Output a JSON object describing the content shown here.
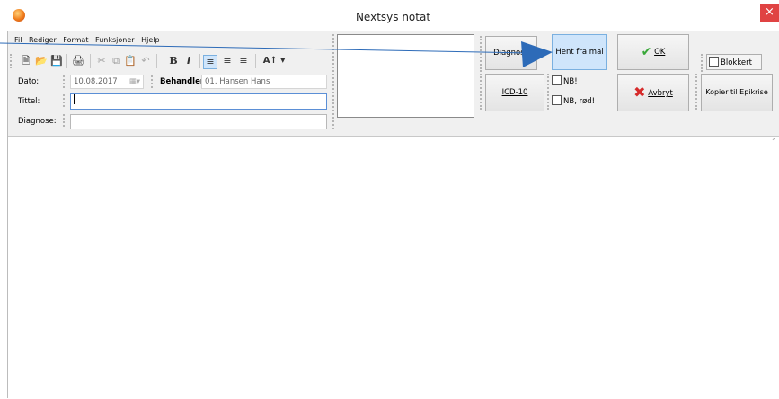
{
  "window": {
    "title": "Nextsys notat",
    "close_glyph": "×"
  },
  "menu": {
    "items": [
      "Fil",
      "Rediger",
      "Format",
      "Funksjoner",
      "Hjelp"
    ]
  },
  "toolbar": {
    "icons": [
      "new-document-icon",
      "open-folder-icon",
      "save-icon",
      "print-icon",
      "cut-icon",
      "copy-icon",
      "paste-icon",
      "undo-icon",
      "bold-icon",
      "italic-icon",
      "align-left-icon",
      "align-center-icon",
      "align-right-icon",
      "font-size-icon"
    ],
    "bold_glyph": "B",
    "italic_glyph": "I",
    "font_glyph": "A↑ ▾"
  },
  "form": {
    "dato_label": "Dato:",
    "dato_value": "10.08.2017",
    "behandler_label": "Behandler:",
    "behandler_value": "01. Hansen Hans",
    "tittel_label": "Tittel:",
    "tittel_value": "",
    "diagnose_label": "Diagnose:",
    "diagnose_value": ""
  },
  "buttons": {
    "diagnose": "Diagnose",
    "hent_fra_mal": "Hent fra mal",
    "ok": "OK",
    "icd10": "ICD-10",
    "avbryt": "Avbryt",
    "kopier": "Kopier til Epikrise"
  },
  "checkboxes": {
    "nb": "NB!",
    "nb_rod": "NB, rød!",
    "blokkert": "Blokkert"
  },
  "colors": {
    "highlight_button": "#cfe5fb",
    "arrow": "#2d6bb8",
    "close": "#e04343"
  }
}
